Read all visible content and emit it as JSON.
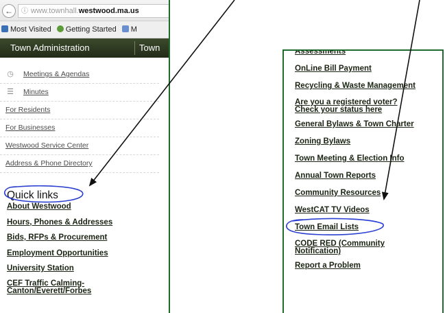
{
  "browser": {
    "back_glyph": "←",
    "url_info": "ⓘ",
    "url_prefix": "www.",
    "url_subdomain": "townhall.",
    "url_host": "westwood.ma.us",
    "bookmarks": [
      "Most Visited",
      "Getting Started",
      "M"
    ]
  },
  "navbar": {
    "items": [
      "Town Administration",
      "Town"
    ]
  },
  "side_menu": [
    {
      "label": "Meetings & Agendas",
      "icon": "clock-icon"
    },
    {
      "label": "Minutes",
      "icon": "list-icon"
    },
    {
      "label": "For Residents"
    },
    {
      "label": "For Businesses"
    },
    {
      "label": "Westwood Service Center"
    },
    {
      "label": "Address & Phone Directory"
    }
  ],
  "quick_links": {
    "title": "Quick links",
    "items": [
      "About Westwood",
      "Hours, Phones & Addresses",
      "Bids, RFPs & Procurement",
      "Employment Opportunities",
      "University Station",
      "CEF Traffic Calming-Canton/Everett/Forbes"
    ]
  },
  "right_links": [
    "Assessments",
    "OnLine Bill Payment",
    "Recycling & Waste Management",
    "Are you a registered voter? Check your status here",
    "General Bylaws & Town Charter",
    "Zoning Bylaws",
    "Town Meeting & Election Info",
    "Annual Town Reports",
    "Community Resources",
    "WestCAT TV Videos",
    "Town Email Lists",
    "CODE RED (Community Notification)",
    "Report a Problem"
  ],
  "colors": {
    "panel_border": "#1f6b2e",
    "link_text": "#1a2413",
    "annotation_circle": "#2a3fd1",
    "arrow": "#111111"
  }
}
